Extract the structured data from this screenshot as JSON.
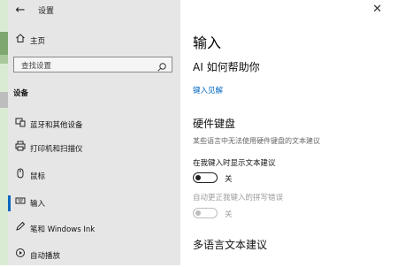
{
  "window": {
    "title": "设置"
  },
  "sidebar": {
    "home": "主页",
    "search_placeholder": "查找设置",
    "section_title": "设备",
    "items": [
      {
        "label": "蓝牙和其他设备",
        "icon": "bluetooth-devices-icon"
      },
      {
        "label": "打印机和扫描仪",
        "icon": "printer-icon"
      },
      {
        "label": "鼠标",
        "icon": "mouse-icon"
      },
      {
        "label": "输入",
        "icon": "keyboard-icon",
        "active": true
      },
      {
        "label": "笔和 Windows Ink",
        "icon": "pen-icon"
      },
      {
        "label": "自动播放",
        "icon": "autoplay-icon"
      }
    ]
  },
  "main": {
    "page_title": "输入",
    "ai_help_title": "AI 如何帮助你",
    "typing_insights_link": "键入见解",
    "hardware_keyboard": {
      "title": "硬件键盘",
      "description": "某些语言中无法使用硬件键盘的文本建议",
      "show_suggestions": {
        "label": "在我键入时显示文本建议",
        "state": "关"
      },
      "autocorrect": {
        "label": "自动更正我键入的拼写错误",
        "state": "关",
        "disabled": true
      }
    },
    "multilingual_title": "多语言文本建议"
  },
  "colors": {
    "accent": "#0067c0",
    "sidebar_bg": "#e6e6e6"
  }
}
